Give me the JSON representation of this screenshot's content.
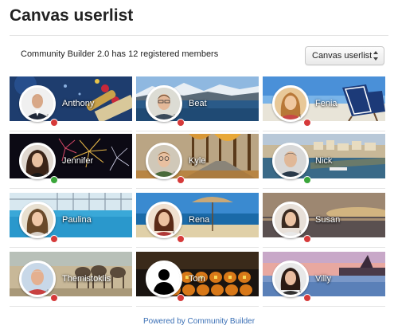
{
  "page": {
    "title": "Canvas userlist",
    "member_count_text": "Community Builder 2.0 has 12 registered members"
  },
  "list_select": {
    "value": "Canvas userlist"
  },
  "members": [
    {
      "name": "Anthony",
      "status": "offline",
      "canvas": "champagne"
    },
    {
      "name": "Beat",
      "status": "offline",
      "canvas": "snow-lake"
    },
    {
      "name": "Fenia",
      "status": "offline",
      "canvas": "beach-chairs"
    },
    {
      "name": "Jennifer",
      "status": "online",
      "canvas": "fireworks"
    },
    {
      "name": "Kyle",
      "status": "offline",
      "canvas": "autumn-road"
    },
    {
      "name": "Nick",
      "status": "online",
      "canvas": "harbor-town"
    },
    {
      "name": "Paulina",
      "status": "offline",
      "canvas": "pool"
    },
    {
      "name": "Rena",
      "status": "offline",
      "canvas": "parasol-sea"
    },
    {
      "name": "Susan",
      "status": "offline",
      "canvas": "sunset-sea"
    },
    {
      "name": "Themistoklis",
      "status": "offline",
      "canvas": "donkeys"
    },
    {
      "name": "Tom",
      "status": "offline",
      "canvas": "halloween"
    },
    {
      "name": "Villy",
      "status": "offline",
      "canvas": "resort-pool"
    }
  ],
  "footer": {
    "link_text": "Powered by Community Builder"
  },
  "colors": {
    "online": "#3aa63a",
    "offline": "#d63a3a",
    "link": "#3a6fb5"
  }
}
